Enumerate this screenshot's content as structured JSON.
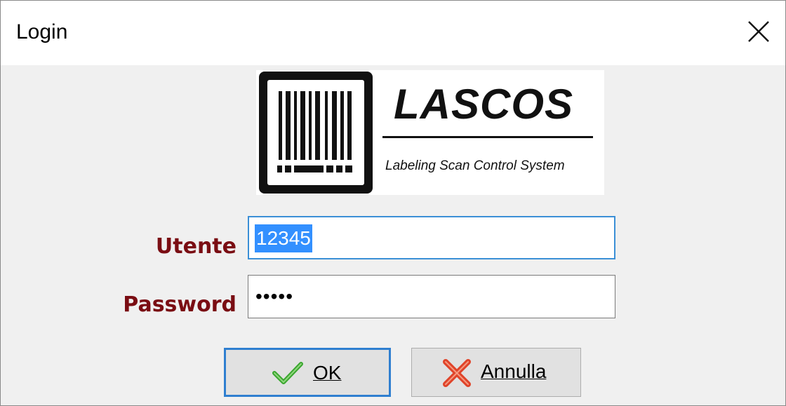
{
  "window": {
    "title": "Login"
  },
  "logo": {
    "name": "LASCOS",
    "tagline": "Labeling Scan Control System"
  },
  "form": {
    "user_label": "Utente",
    "user_value": "12345",
    "password_label": "Password",
    "password_mask": "•••••"
  },
  "buttons": {
    "ok_label": "OK",
    "ok_icon": "checkmark-icon",
    "cancel_label": "Annulla",
    "cancel_icon": "x-mark-icon"
  },
  "colors": {
    "label": "#7a0d13",
    "focus_border": "#3b8fd6",
    "selection": "#3390ff",
    "ok_check": "#3aa62f",
    "cancel_x": "#e0442a"
  }
}
